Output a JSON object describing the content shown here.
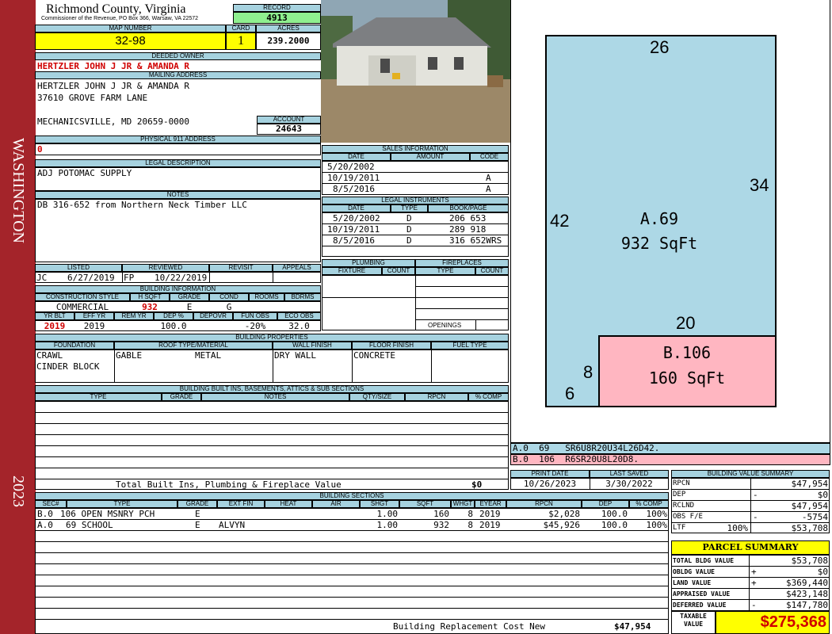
{
  "side": {
    "label": "WASHINGTON",
    "year": "2023"
  },
  "county": {
    "name": "Richmond County, Virginia",
    "address": "Commissioner of the Revenue, PO Box 366, Warsaw, VA 22572"
  },
  "record": {
    "label": "RECORD",
    "value": "4913"
  },
  "map": {
    "label": "MAP NUMBER",
    "value": "32-98"
  },
  "card": {
    "label": "CARD",
    "value": "1"
  },
  "acres": {
    "label": "ACRES",
    "value": "239.2000"
  },
  "owner": {
    "label": "DEEDED OWNER",
    "value": "HERTZLER JOHN J JR & AMANDA R"
  },
  "mailing": {
    "label": "MAILING ADDRESS",
    "line1": "HERTZLER JOHN J JR & AMANDA R",
    "line2": "37610 GROVE FARM LANE",
    "line3": "MECHANICSVILLE, MD 20659-0000"
  },
  "account": {
    "label": "ACCOUNT",
    "value": "24643"
  },
  "physical": {
    "label": "PHYSICAL 911 ADDRESS",
    "value": "0"
  },
  "legal": {
    "label": "LEGAL DESCRIPTION",
    "value": "ADJ POTOMAC SUPPLY"
  },
  "notes": {
    "label": "NOTES",
    "value": "DB 316-652 from Northern Neck Timber LLC"
  },
  "listing": {
    "listed_label": "LISTED",
    "listed_by": "JC",
    "listed_date": "6/27/2019",
    "reviewed_label": "REVIEWED",
    "reviewed_by": "FP",
    "reviewed_date": "10/22/2019",
    "revisit_label": "REVISIT",
    "appeals_label": "APPEALS"
  },
  "building_info": {
    "label": "BUILDING INFORMATION",
    "h": [
      "CONSTRUCTION STYLE",
      "H SQFT",
      "GRADE",
      "COND",
      "ROOMS",
      "BDRMS"
    ],
    "v": [
      "COMMERCIAL",
      "932",
      "E",
      "G",
      "",
      ""
    ],
    "h2": [
      "YR BLT",
      "EFF YR",
      "REM YR",
      "DEP %",
      "DEPOVR",
      "FUN OBS",
      "ECO OBS"
    ],
    "v2": [
      "2019",
      "2019",
      "",
      "100.0",
      "",
      "-20%",
      "32.0"
    ]
  },
  "sales": {
    "label": "SALES INFORMATION",
    "h": [
      "DATE",
      "AMOUNT",
      "CODE"
    ],
    "rows": [
      [
        "5/20/2002",
        "",
        ""
      ],
      [
        "10/19/2011",
        "",
        "A"
      ],
      [
        "8/5/2016",
        "",
        "A"
      ]
    ]
  },
  "instruments": {
    "label": "LEGAL INSTRUMENTS",
    "h": [
      "DATE",
      "TYPE",
      "BOOK/PAGE"
    ],
    "rows": [
      [
        "5/20/2002",
        "D",
        "206 653"
      ],
      [
        "10/19/2011",
        "D",
        "289 918"
      ],
      [
        "8/5/2016",
        "D",
        "316 652WRS"
      ]
    ]
  },
  "plumbing": {
    "label": "PLUMBING",
    "h": [
      "FIXTURE",
      "COUNT"
    ]
  },
  "fireplaces": {
    "label": "FIREPLACES",
    "h": [
      "TYPE",
      "COUNT"
    ],
    "openings": "OPENINGS"
  },
  "props": {
    "label": "BUILDING PROPERTIES",
    "h": [
      "FOUNDATION",
      "ROOF TYPE/MATERIAL",
      "WALL FINISH",
      "FLOOR FINISH",
      "FUEL TYPE"
    ],
    "foundation1": "CRAWL",
    "foundation2": "CINDER BLOCK",
    "roof_type": "GABLE",
    "roof_mat": "METAL",
    "wall": "DRY WALL",
    "floor": "CONCRETE"
  },
  "builtins": {
    "label": "BUILDING BUILT INS, BASEMENTS, ATTICS & SUB SECTIONS",
    "h": [
      "TYPE",
      "GRADE",
      "NOTES",
      "QTY/SIZE",
      "RPCN",
      "% COMP"
    ],
    "total_label": "Total Built Ins, Plumbing & Fireplace Value",
    "total": "$0"
  },
  "sketch": {
    "a_label": "A.69",
    "a_area": "932 SqFt",
    "b_label": "B.106",
    "b_area": "160 SqFt",
    "d26": "26",
    "d34": "34",
    "d42": "42",
    "d20": "20",
    "d8": "8",
    "d6": "6"
  },
  "vectors": {
    "a": "A.0  69   SR6U8R20U34L26D42.",
    "b": "B.0  106  R6SR20U8L20D8."
  },
  "print": {
    "print_label": "PRINT DATE",
    "print_date": "10/26/2023",
    "saved_label": "LAST SAVED",
    "saved_date": "3/30/2022"
  },
  "bvs": {
    "label": "BUILDING VALUE SUMMARY",
    "rows": [
      [
        "RPCN",
        "",
        "$47,954"
      ],
      [
        "DEP",
        "-",
        "$0"
      ],
      [
        "RCLND",
        "",
        "$47,954"
      ],
      [
        "OBS F/E",
        "-",
        "-5754"
      ],
      [
        "LTF",
        "100%",
        "$53,708"
      ]
    ]
  },
  "sections": {
    "label": "BUILDING SECTIONS",
    "h": [
      "SEC#",
      "TYPE",
      "GRADE",
      "EXT FIN",
      "HEAT",
      "AIR",
      "SHGT",
      "SQFT",
      "WHGT",
      "EYEAR",
      "RPCN",
      "DEP",
      "% COMP"
    ],
    "rows": [
      [
        "B.0",
        "106 OPEN MSNRY PCH",
        "E",
        "",
        "",
        "",
        "1.00",
        "160",
        "8",
        "2019",
        "$2,028",
        "100.0",
        "100%"
      ],
      [
        "A.0",
        "69 SCHOOL",
        "E",
        "ALVYN",
        "",
        "",
        "1.00",
        "932",
        "8",
        "2019",
        "$45,926",
        "100.0",
        "100%"
      ]
    ],
    "total_label": "Building Replacement Cost New",
    "total": "$47,954"
  },
  "parcel": {
    "label": "PARCEL SUMMARY",
    "rows": [
      [
        "TOTAL BLDG VALUE",
        "",
        "$53,708"
      ],
      [
        "OBLDG VALUE",
        "+",
        "$0"
      ],
      [
        "LAND VALUE",
        "+",
        "$369,440"
      ],
      [
        "APPRAISED VALUE",
        "",
        "$423,148"
      ],
      [
        "DEFERRED VALUE",
        "-",
        "$147,780"
      ]
    ],
    "taxable1": "TAXABLE",
    "taxable2": "VALUE",
    "taxable": "$275,368"
  },
  "colors": {
    "sidebar": "#a4242a",
    "header": "#a6d2df",
    "yellow": "#ffff00",
    "green": "#8ff08f",
    "sketch_a": "#add8e6",
    "sketch_b": "#ffb6c1"
  }
}
